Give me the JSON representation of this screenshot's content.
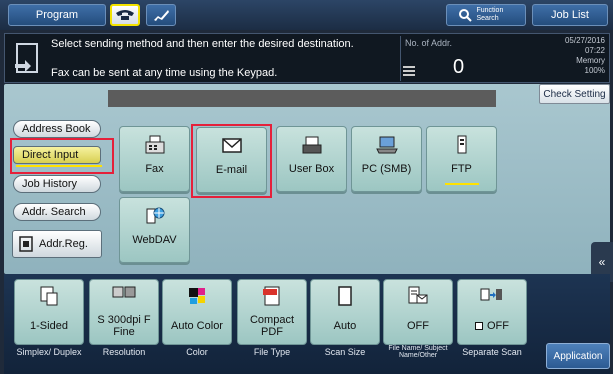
{
  "topbar": {
    "program_label": "Program",
    "function_search_label": "Function Search",
    "job_list_label": "Job List"
  },
  "message": {
    "line1": "Select sending method and then enter the desired destination.",
    "line2": "Fax can be sent at any time using the Keypad.",
    "addr_label": "No. of Addr.",
    "addr_count": "0",
    "date": "05/27/2016",
    "time": "07:22",
    "memory_label": "Memory",
    "memory_value": "100%"
  },
  "check_setting_label": "Check Setting",
  "left_menu": {
    "items": [
      {
        "label": "Address Book"
      },
      {
        "label": "Direct Input"
      },
      {
        "label": "Job History"
      },
      {
        "label": "Addr. Search"
      }
    ],
    "addr_reg_label": "Addr.Reg."
  },
  "destinations": [
    {
      "label": "Fax",
      "icon": "fax-icon"
    },
    {
      "label": "E-mail",
      "icon": "envelope-icon"
    },
    {
      "label": "User Box",
      "icon": "box-icon"
    },
    {
      "label": "PC (SMB)",
      "icon": "pc-icon"
    },
    {
      "label": "FTP",
      "icon": "ftp-icon"
    },
    {
      "label": "WebDAV",
      "icon": "webdav-icon"
    }
  ],
  "settings": [
    {
      "value": "1-Sided",
      "caption": "Simplex/ Duplex"
    },
    {
      "value": "S 300dpi F Fine",
      "caption": "Resolution"
    },
    {
      "value": "Auto Color",
      "caption": "Color"
    },
    {
      "value": "Compact PDF",
      "caption": "File Type"
    },
    {
      "value": "Auto",
      "caption": "Scan Size"
    },
    {
      "value": "OFF",
      "caption": "File Name/ Subject Name/Other"
    },
    {
      "value": "OFF",
      "caption": "Separate Scan"
    }
  ],
  "application_label": "Application",
  "colors": {
    "highlight": "#e5203a",
    "selected_yellow": "#ffe200",
    "panel": "#a9c7cf"
  }
}
